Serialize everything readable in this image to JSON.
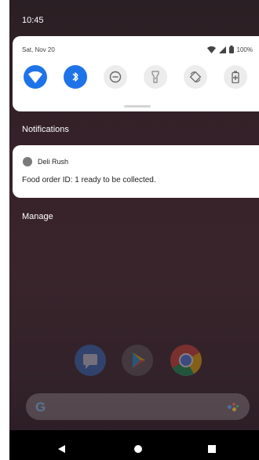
{
  "status_bar": {
    "time": "10:45"
  },
  "quick_settings": {
    "date": "Sat, Nov 20",
    "battery": "100%",
    "tiles": [
      {
        "name": "wifi",
        "state": "on"
      },
      {
        "name": "bluetooth",
        "state": "on"
      },
      {
        "name": "do-not-disturb",
        "state": "off"
      },
      {
        "name": "flashlight",
        "state": "off"
      },
      {
        "name": "auto-rotate",
        "state": "off"
      },
      {
        "name": "battery-saver",
        "state": "off"
      }
    ]
  },
  "notifications": {
    "header": "Notifications",
    "items": [
      {
        "app": "Deli Rush",
        "text": "Food order ID: 1 ready to be collected."
      }
    ],
    "manage_label": "Manage"
  },
  "home": {
    "dock": [
      "messages-icon",
      "play-store-icon",
      "chrome-icon"
    ],
    "search_logo": "G"
  },
  "colors": {
    "accent": "#1f73e8",
    "tile_off": "#ececec",
    "scrim": "#352129"
  }
}
